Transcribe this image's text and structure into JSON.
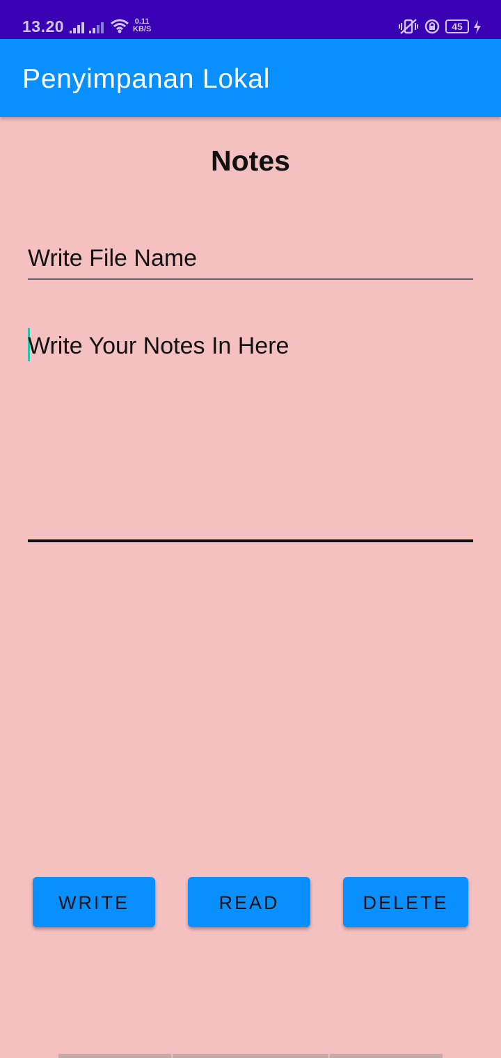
{
  "status_bar": {
    "time": "13.20",
    "net_speed_value": "0.11",
    "net_speed_unit": "KB/S",
    "battery_level": "45"
  },
  "app_bar": {
    "title": "Penyimpanan Lokal"
  },
  "main": {
    "heading": "Notes",
    "file_name_placeholder": "Write File Name",
    "notes_placeholder": "Write Your Notes In Here"
  },
  "buttons": {
    "write": "WRITE",
    "read": "READ",
    "delete": "DELETE"
  },
  "colors": {
    "status_bar": "#3a00b4",
    "app_bar": "#0a8ffe",
    "background": "#f4c0c0",
    "button": "#0a8ffe",
    "cursor": "#1ec9b0"
  }
}
